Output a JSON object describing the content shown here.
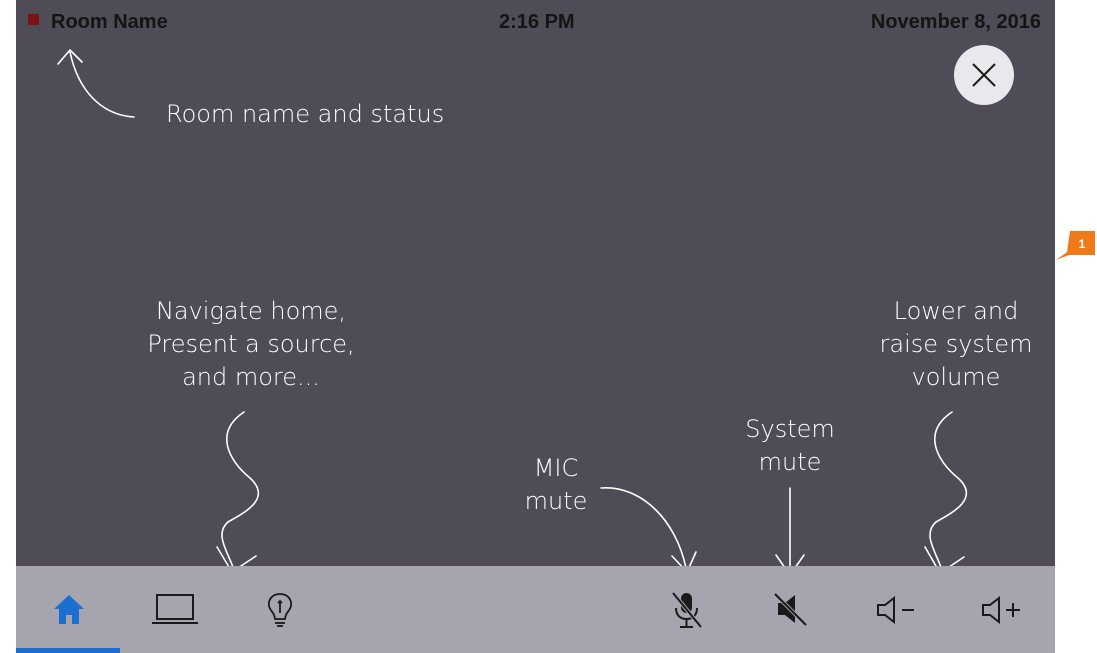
{
  "status_bar": {
    "room_name": "Room Name",
    "status_color": "#7a1419",
    "time": "2:16 PM",
    "date": "November 8, 2016"
  },
  "close_button": {
    "icon": "close-icon"
  },
  "annotations": {
    "room_status": "Room name and status",
    "navigate": [
      "Navigate home,",
      "Present a source,",
      "and more..."
    ],
    "volume": [
      "Lower and",
      "raise system",
      "volume"
    ],
    "system_mute": [
      "System",
      "mute"
    ],
    "mic_mute": [
      "MIC",
      "mute"
    ]
  },
  "nav_bar": {
    "items": [
      {
        "icon": "home-icon",
        "selected": true
      },
      {
        "icon": "laptop-icon",
        "selected": false
      },
      {
        "icon": "lightbulb-icon",
        "selected": false
      },
      {
        "icon": "mic-mute-icon",
        "selected": false
      },
      {
        "icon": "speaker-mute-icon",
        "selected": false
      },
      {
        "icon": "volume-down-icon",
        "selected": false
      },
      {
        "icon": "volume-up-icon",
        "selected": false
      }
    ],
    "accent_color": "#1b6fd0"
  },
  "callout": {
    "number": "1",
    "color": "#f07a1a"
  },
  "colors": {
    "panel_background": "#4f4c58",
    "nav_background": "#a6a4ae"
  }
}
